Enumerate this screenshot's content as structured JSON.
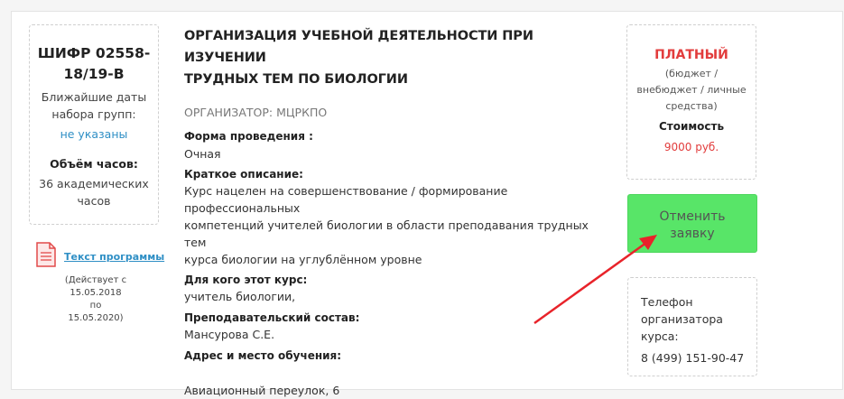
{
  "course": {
    "code": "ШИФР 02558-18/19-В",
    "code_line1": "ШИФР 02558-",
    "code_line2": "18/19-В",
    "dates_label_1": "Ближайшие даты",
    "dates_label_2": "набора групп:",
    "dates_value": "не указаны",
    "hours_label": "Объём часов:",
    "hours_value_1": "36 академических",
    "hours_value_2": "часов"
  },
  "program": {
    "link_text": "Текст программы",
    "valid_1": "(Действует с",
    "valid_2": "15.05.2018 по",
    "valid_3": "15.05.2020)",
    "icon": "document-icon"
  },
  "main": {
    "title_1": "ОРГАНИЗАЦИЯ УЧЕБНОЙ ДЕЯТЕЛЬНОСТИ ПРИ ИЗУЧЕНИИ",
    "title_2": "ТРУДНЫХ ТЕМ ПО БИОЛОГИИ",
    "organizer": "ОРГАНИЗАТОР: МЦРКПО",
    "form_label": "Форма проведения :",
    "form_value": "Очная",
    "desc_label": "Краткое описание:",
    "desc_1": "Курс нацелен на совершенствование / формирование профессиональных",
    "desc_2": "компетенций учителей биологии в области преподавания трудных тем",
    "desc_3": "курса биологии на углублённом уровне",
    "audience_label": "Для кого этот курс:",
    "audience_value": "учитель биологии,",
    "staff_label": "Преподавательский состав:",
    "staff_value": "Мансурова С.Е.",
    "address_label": "Адрес и место обучения:",
    "address_value": "Авиационный переулок, 6"
  },
  "pricing": {
    "type": "ПЛАТНЫЙ",
    "sub_1": "(бюджет /",
    "sub_2": "внебюджет / личные",
    "sub_3": "средства)",
    "cost_label": "Стоимость",
    "cost_value": "9000 руб."
  },
  "action": {
    "button_1": "Отменить",
    "button_2": "заявку"
  },
  "contact": {
    "line_1": "Телефон",
    "line_2": "организатора",
    "line_3": "курса:",
    "phone": "8 (499) 151-90-47"
  },
  "colors": {
    "accent_red": "#e23c3c",
    "link_blue": "#2f8fc5",
    "button_green": "#58e568",
    "arrow_red": "#e8232a"
  }
}
